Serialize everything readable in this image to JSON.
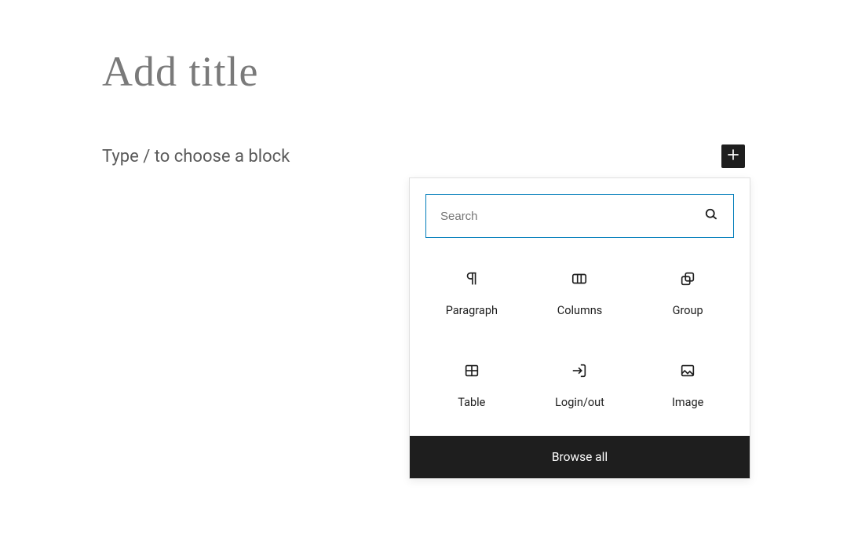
{
  "editor": {
    "title_placeholder": "Add title",
    "content_placeholder": "Type / to choose a block"
  },
  "inserter": {
    "search_placeholder": "Search",
    "blocks": [
      {
        "label": "Paragraph",
        "icon": "paragraph-icon"
      },
      {
        "label": "Columns",
        "icon": "columns-icon"
      },
      {
        "label": "Group",
        "icon": "group-icon"
      },
      {
        "label": "Table",
        "icon": "table-icon"
      },
      {
        "label": "Login/out",
        "icon": "login-icon"
      },
      {
        "label": "Image",
        "icon": "image-icon"
      }
    ],
    "browse_all_label": "Browse all"
  },
  "colors": {
    "accent": "#007cba",
    "dark": "#1e1e1e"
  }
}
